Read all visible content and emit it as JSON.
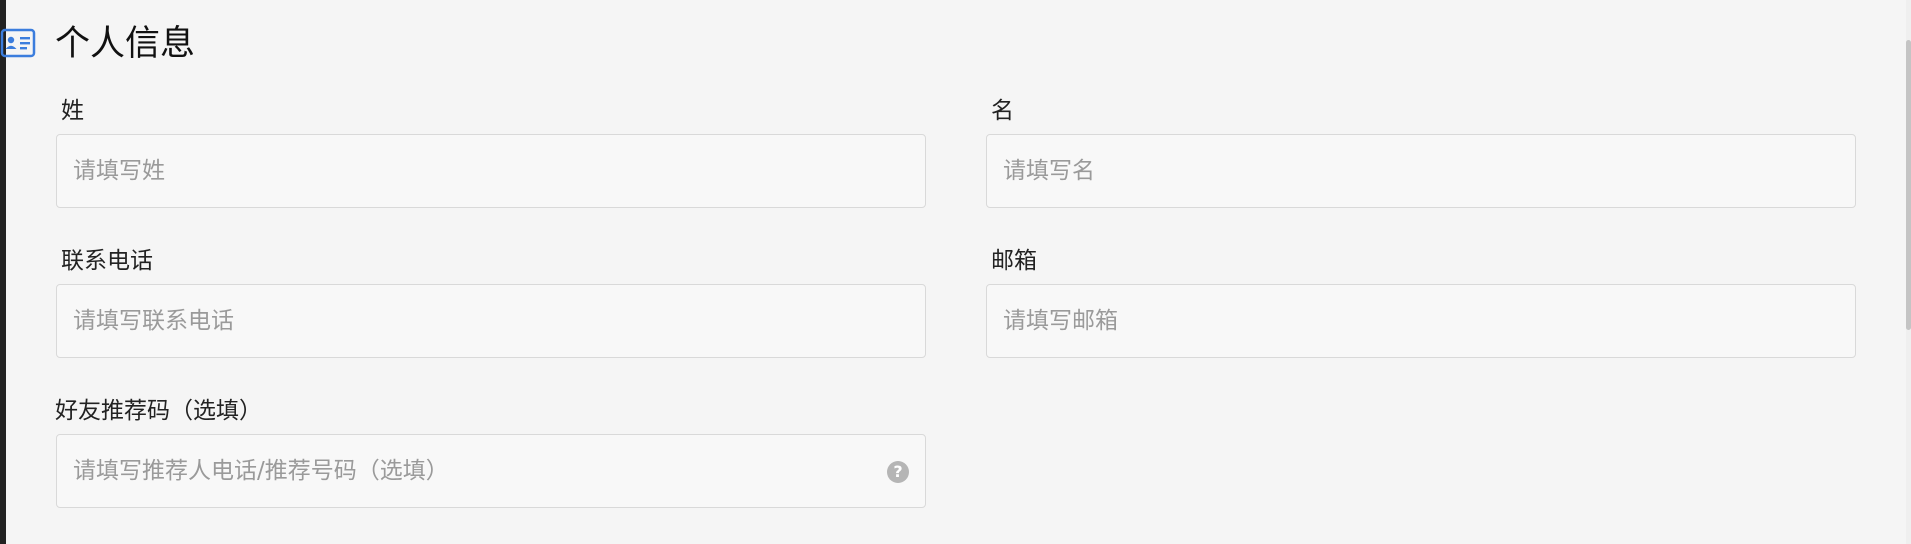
{
  "section": {
    "title": "个人信息",
    "icon": "id-card-icon",
    "accent_color": "#3b7ddd"
  },
  "fields": {
    "last_name": {
      "label": "姓",
      "placeholder": "请填写姓",
      "value": ""
    },
    "first_name": {
      "label": "名",
      "placeholder": "请填写名",
      "value": ""
    },
    "phone": {
      "label": "联系电话",
      "placeholder": "请填写联系电话",
      "value": ""
    },
    "email": {
      "label": "邮箱",
      "placeholder": "请填写邮箱",
      "value": ""
    },
    "referral": {
      "label": "好友推荐码（选填）",
      "placeholder": "请填写推荐人电话/推荐号码（选填）",
      "value": "",
      "help_icon": "question-mark-icon",
      "help_glyph": "?"
    }
  }
}
